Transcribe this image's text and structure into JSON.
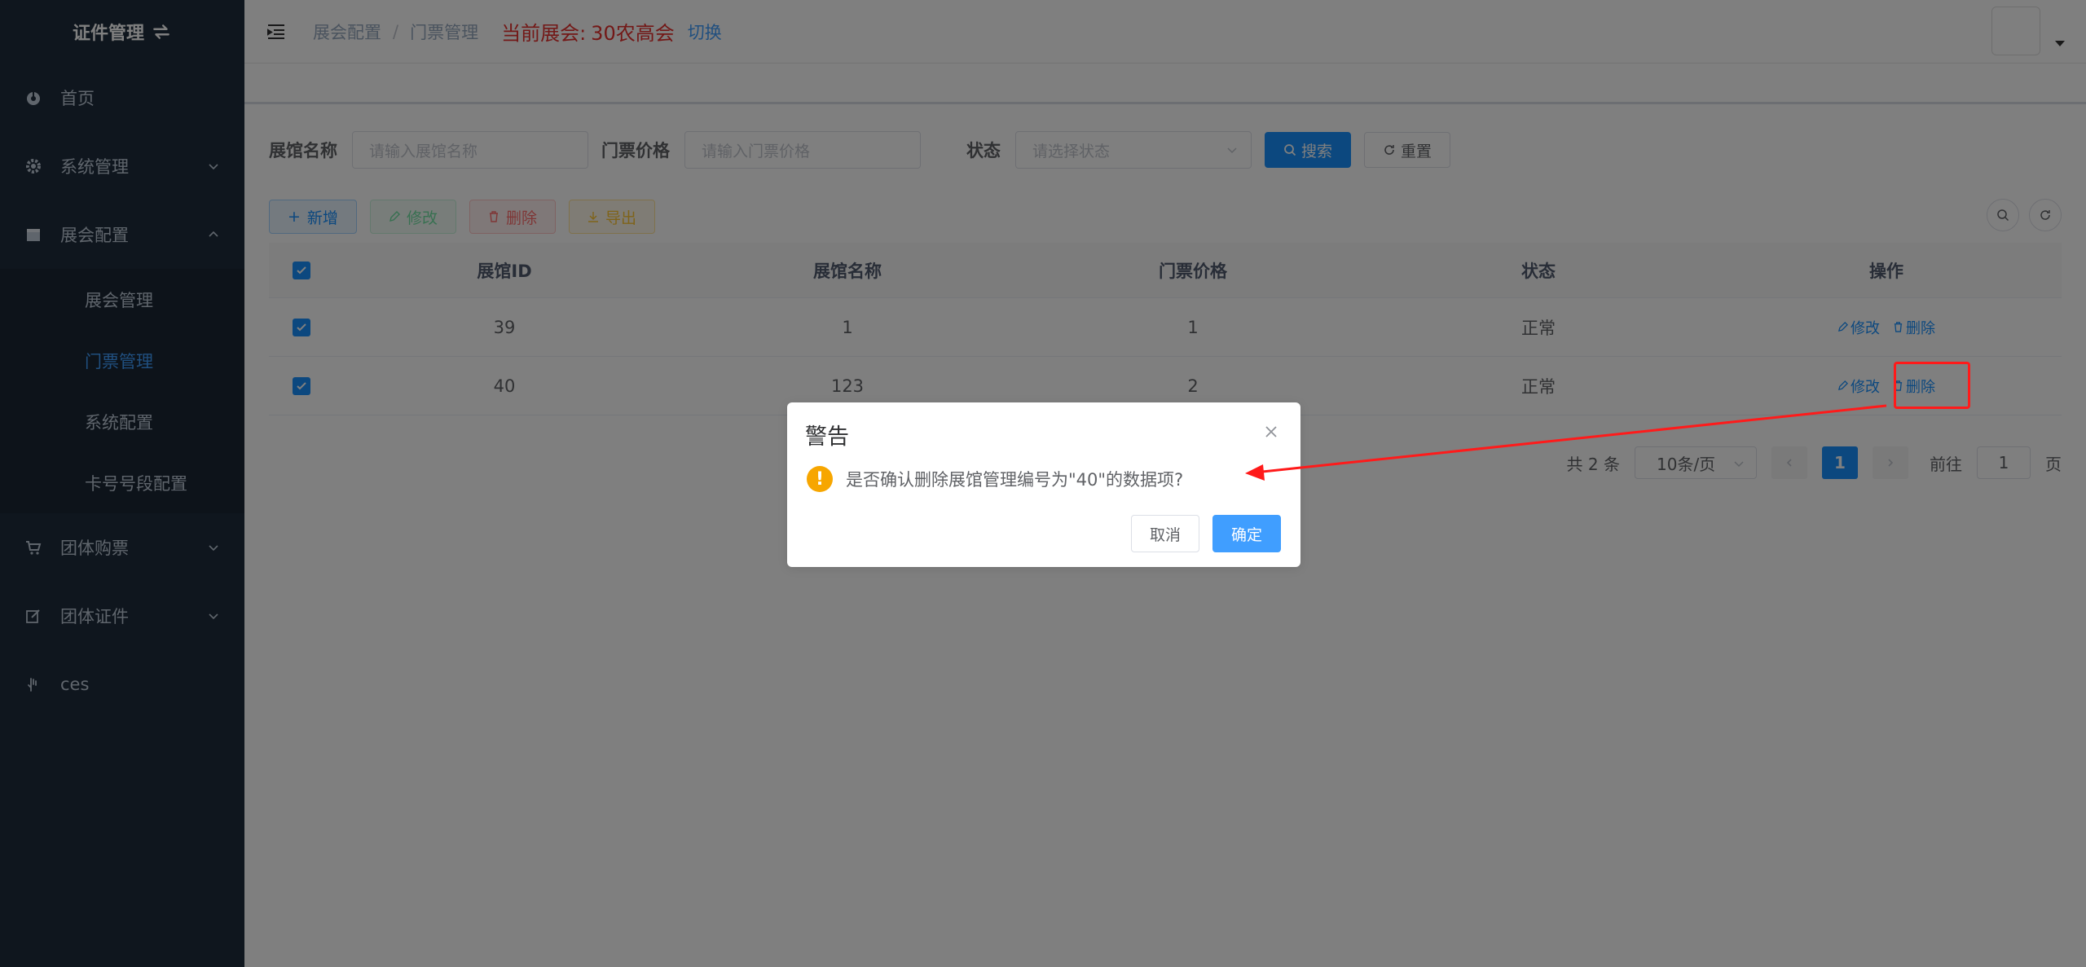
{
  "sidebar": {
    "logo_title": "证件管理",
    "items": [
      {
        "label": "首页"
      },
      {
        "label": "系统管理"
      },
      {
        "label": "展会配置"
      },
      {
        "label": "团体购票"
      },
      {
        "label": "团体证件"
      },
      {
        "label": "ces"
      }
    ],
    "submenu": [
      {
        "label": "展会管理"
      },
      {
        "label": "门票管理"
      },
      {
        "label": "系统配置"
      },
      {
        "label": "卡号号段配置"
      }
    ]
  },
  "header": {
    "breadcrumb": [
      "展会配置",
      "门票管理"
    ],
    "current_expo_label": "当前展会:",
    "current_expo_value": "30农高会",
    "switch_label": "切换"
  },
  "search": {
    "name_label": "展馆名称",
    "name_placeholder": "请输入展馆名称",
    "price_label": "门票价格",
    "price_placeholder": "请输入门票价格",
    "status_label": "状态",
    "status_placeholder": "请选择状态",
    "search_button": "搜索",
    "reset_button": "重置"
  },
  "toolbar": {
    "add": "新增",
    "edit": "修改",
    "delete": "删除",
    "export": "导出"
  },
  "table": {
    "columns": [
      "展馆ID",
      "展馆名称",
      "门票价格",
      "状态",
      "操作"
    ],
    "rows": [
      {
        "id": "39",
        "name": "1",
        "price": "1",
        "status": "正常",
        "edit": "修改",
        "delete": "删除"
      },
      {
        "id": "40",
        "name": "123",
        "price": "2",
        "status": "正常",
        "edit": "修改",
        "delete": "删除"
      }
    ]
  },
  "pagination": {
    "total": "共 2 条",
    "page_size": "10条/页",
    "current_page": "1",
    "goto_label": "前往",
    "goto_value": "1",
    "page_suffix": "页"
  },
  "dialog": {
    "title": "警告",
    "message": "是否确认删除展馆管理编号为\"40\"的数据项?",
    "cancel": "取消",
    "confirm": "确定"
  },
  "colors": {
    "sidebar_bg": "#1f2d3d",
    "primary": "#1890ff",
    "annotation_red": "#ff1a1a",
    "warning": "#f7a600"
  }
}
